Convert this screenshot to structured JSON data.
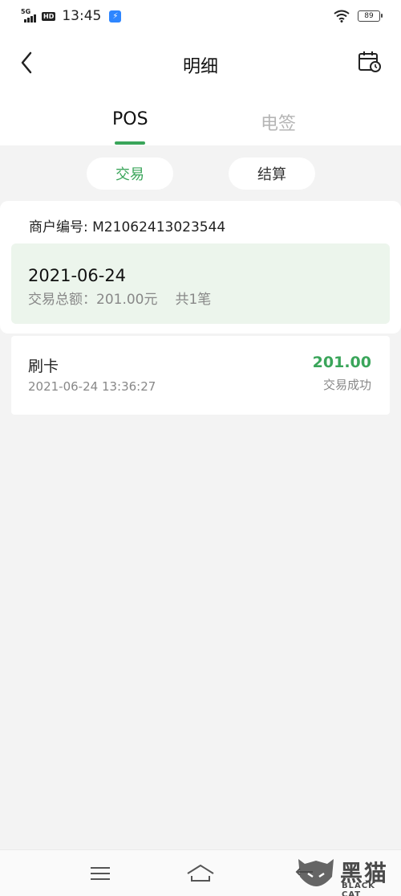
{
  "status_bar": {
    "network": "5G",
    "hd": "HD",
    "time": "13:45",
    "battery": "89"
  },
  "header": {
    "title": "明细"
  },
  "tabs": [
    {
      "label": "POS"
    },
    {
      "label": "电签"
    }
  ],
  "filters": {
    "trade_label": "交易",
    "settle_label": "结算"
  },
  "merchant": {
    "label": "商户编号: ",
    "id": "M21062413023544"
  },
  "summary": {
    "date": "2021-06-24",
    "total_text": "交易总额：201.00元",
    "count_text": "共1笔"
  },
  "transactions": [
    {
      "type": "刷卡",
      "time": "2021-06-24 13:36:27",
      "amount": "201.00",
      "status": "交易成功"
    }
  ],
  "watermark": {
    "text": "黑猫",
    "sub": "BLACK CAT"
  },
  "colors": {
    "accent": "#3aa55a",
    "summary_bg": "#ecf5ec",
    "page_bg": "#f3f3f3"
  }
}
